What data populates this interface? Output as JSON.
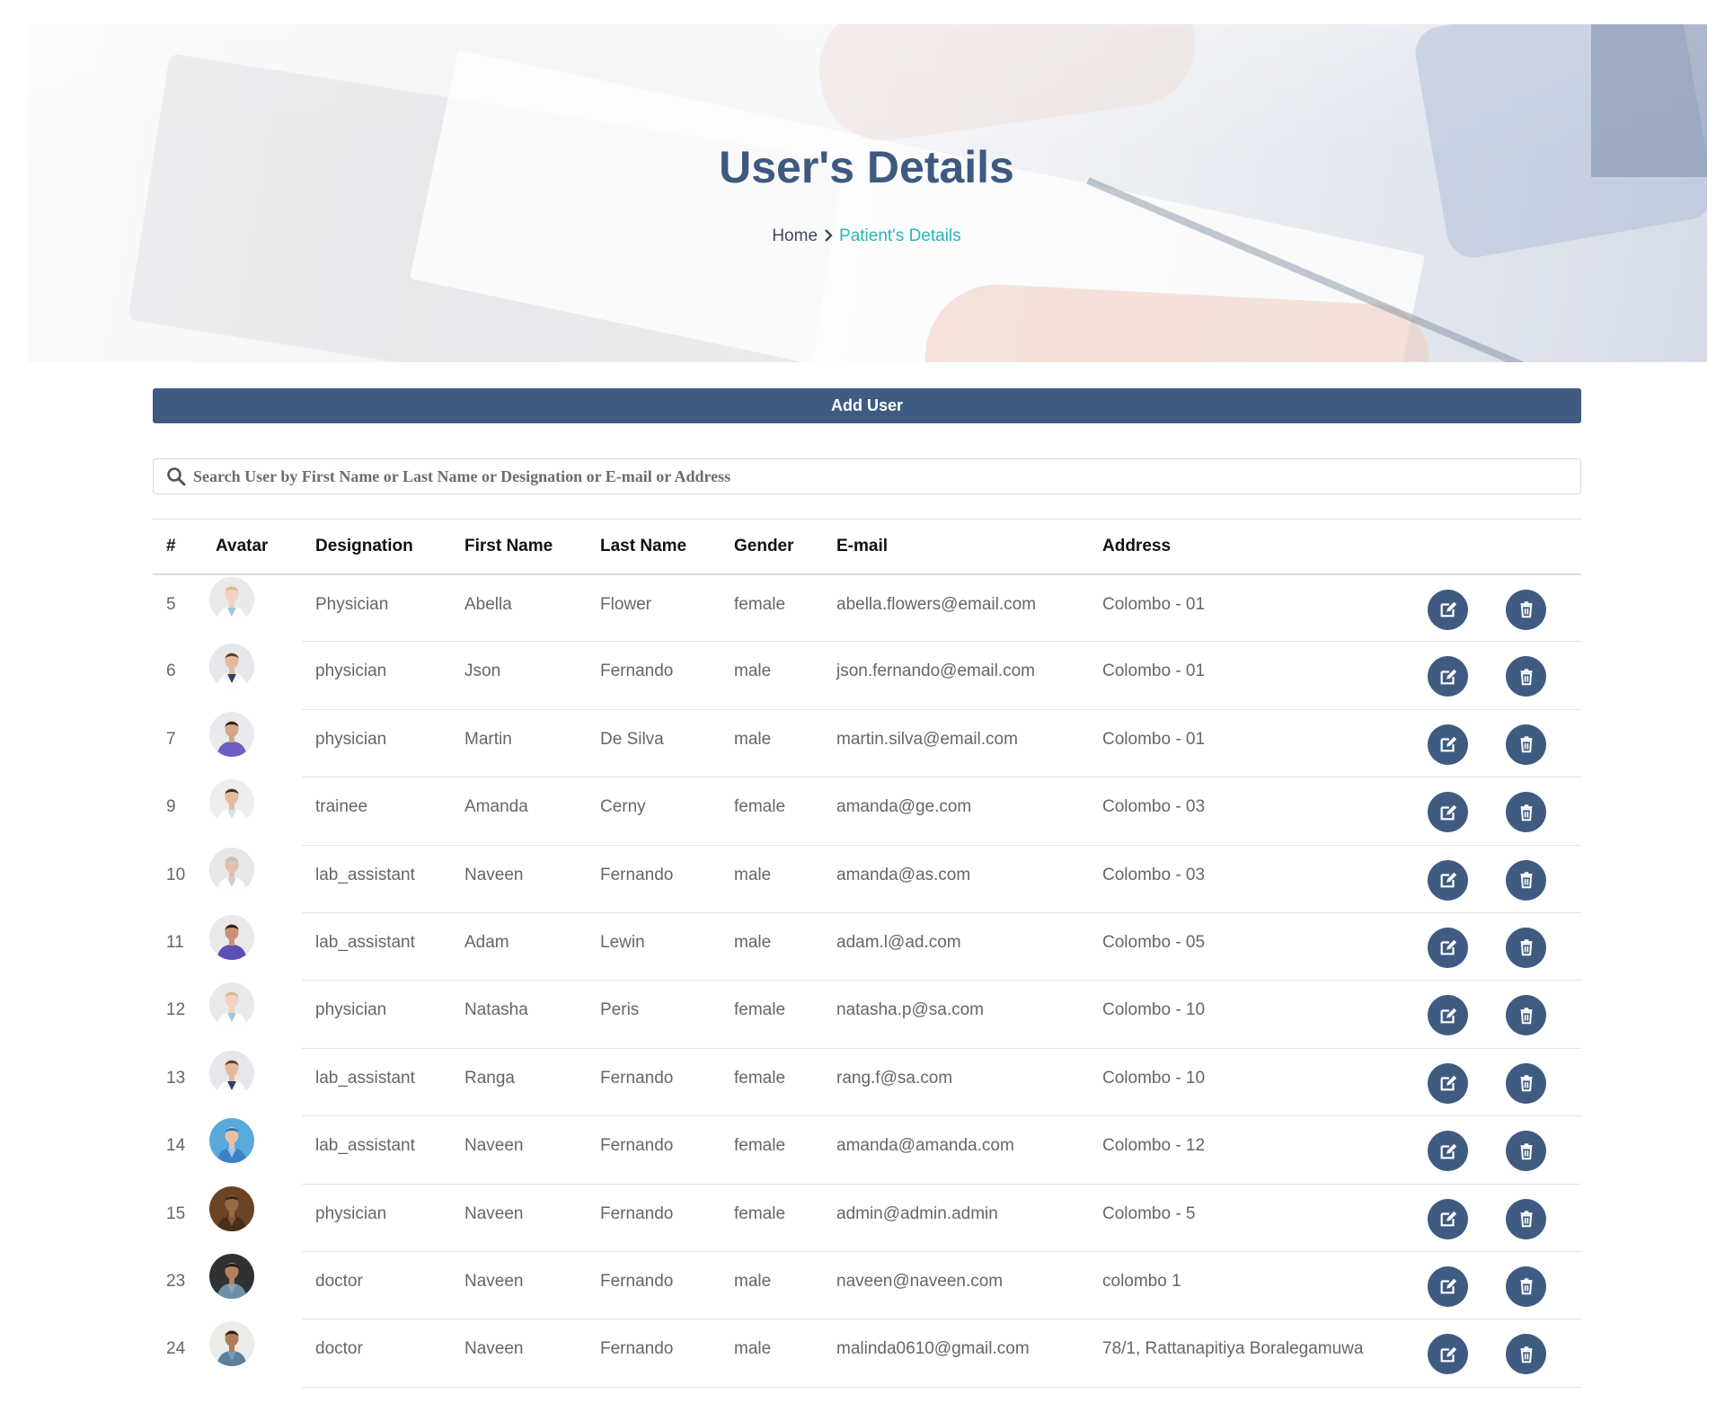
{
  "header": {
    "title": "User's Details",
    "breadcrumb": {
      "home": "Home",
      "current": "Patient's Details"
    }
  },
  "toolbar": {
    "add_user_label": "Add User"
  },
  "search": {
    "placeholder": "Search User by First Name or Last Name or Designation or E-mail or Address",
    "value": ""
  },
  "table": {
    "columns": [
      "#",
      "Avatar",
      "Designation",
      "First Name",
      "Last Name",
      "Gender",
      "E-mail",
      "Address"
    ],
    "rows": [
      {
        "id": "5",
        "designation": "Physician",
        "first_name": "Abella",
        "last_name": "Flower",
        "gender": "female",
        "email": "abella.flowers@email.com",
        "address": "Colombo - 01",
        "avatar": "female-doctor-light"
      },
      {
        "id": "6",
        "designation": "physician",
        "first_name": "Json",
        "last_name": "Fernando",
        "gender": "male",
        "email": "json.fernando@email.com",
        "address": "Colombo - 01",
        "avatar": "male-doctor-tie"
      },
      {
        "id": "7",
        "designation": "physician",
        "first_name": "Martin",
        "last_name": "De Silva",
        "gender": "male",
        "email": "martin.silva@email.com",
        "address": "Colombo - 01",
        "avatar": "male-scrubs-purple"
      },
      {
        "id": "9",
        "designation": "trainee",
        "first_name": "Amanda",
        "last_name": "Cerny",
        "gender": "female",
        "email": "amanda@ge.com",
        "address": "Colombo - 03",
        "avatar": "male-doctor-white"
      },
      {
        "id": "10",
        "designation": "lab_assistant",
        "first_name": "Naveen",
        "last_name": "Fernando",
        "gender": "male",
        "email": "amanda@as.com",
        "address": "Colombo - 03",
        "avatar": "older-doctor"
      },
      {
        "id": "11",
        "designation": "lab_assistant",
        "first_name": "Adam",
        "last_name": "Lewin",
        "gender": "male",
        "email": "adam.l@ad.com",
        "address": "Colombo - 05",
        "avatar": "male-scrubs-purple-beard"
      },
      {
        "id": "12",
        "designation": "physician",
        "first_name": "Natasha",
        "last_name": "Peris",
        "gender": "female",
        "email": "natasha.p@sa.com",
        "address": "Colombo - 10",
        "avatar": "female-doctor-light"
      },
      {
        "id": "13",
        "designation": "lab_assistant",
        "first_name": "Ranga",
        "last_name": "Fernando",
        "gender": "female",
        "email": "rang.f@sa.com",
        "address": "Colombo - 10",
        "avatar": "male-doctor-tie"
      },
      {
        "id": "14",
        "designation": "lab_assistant",
        "first_name": "Naveen",
        "last_name": "Fernando",
        "gender": "female",
        "email": "amanda@amanda.com",
        "address": "Colombo - 12",
        "avatar": "surgeon-blue"
      },
      {
        "id": "15",
        "designation": "physician",
        "first_name": "Naveen",
        "last_name": "Fernando",
        "gender": "female",
        "email": "admin@admin.admin",
        "address": "Colombo - 5",
        "avatar": "brown-photo"
      },
      {
        "id": "23",
        "designation": "doctor",
        "first_name": "Naveen",
        "last_name": "Fernando",
        "gender": "male",
        "email": "naveen@naveen.com",
        "address": "colombo 1",
        "avatar": "man-dark-bg"
      },
      {
        "id": "24",
        "designation": "doctor",
        "first_name": "Naveen",
        "last_name": "Fernando",
        "gender": "male",
        "email": "malinda0610@gmail.com",
        "address": "78/1, Rattanapitiya Boralegamuwa",
        "avatar": "man-light-bg"
      }
    ],
    "actions": {
      "edit_icon": "edit-icon",
      "delete_icon": "trash-icon"
    }
  },
  "colors": {
    "primary": "#3f5b82",
    "accent": "#2ab5b5",
    "title": "#3f5a80"
  }
}
